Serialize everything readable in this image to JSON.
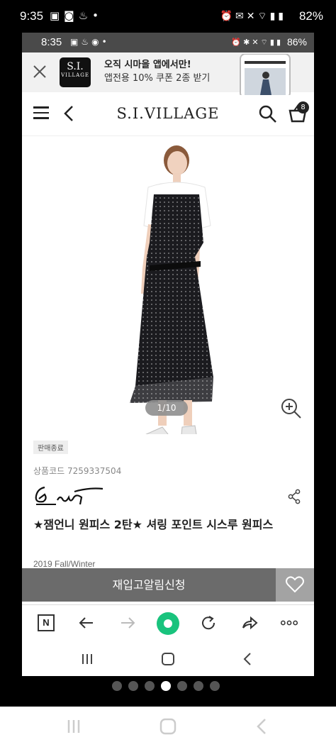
{
  "outer_status": {
    "time": "9:35",
    "battery": "82%"
  },
  "inner_status": {
    "time": "8:35",
    "battery": "86%"
  },
  "banner": {
    "logo_line1": "S.I.",
    "logo_line2": "VILLAGE",
    "promo_line1": "오직 시마을 앱에서만!",
    "promo_line2": "앱전용 10% 쿠폰 2종 받기"
  },
  "header": {
    "brand": "S.I.VILLAGE",
    "cart_count": "8"
  },
  "gallery": {
    "counter": "1/10"
  },
  "product": {
    "status": "판매종료",
    "code": "상품코드 7259337504",
    "title": "★잼언니 원피스 2탄★ 셔링 포인트 시스루 원피스",
    "season": "2019 Fall/Winter"
  },
  "cta": {
    "restock_label": "재입고알림신청"
  },
  "pager": {
    "total": 7,
    "active": 3
  },
  "colors": {
    "cta_bg": "#6b6b6b",
    "wish_bg": "#a3a3a3",
    "browser_green": "#19c37d"
  }
}
